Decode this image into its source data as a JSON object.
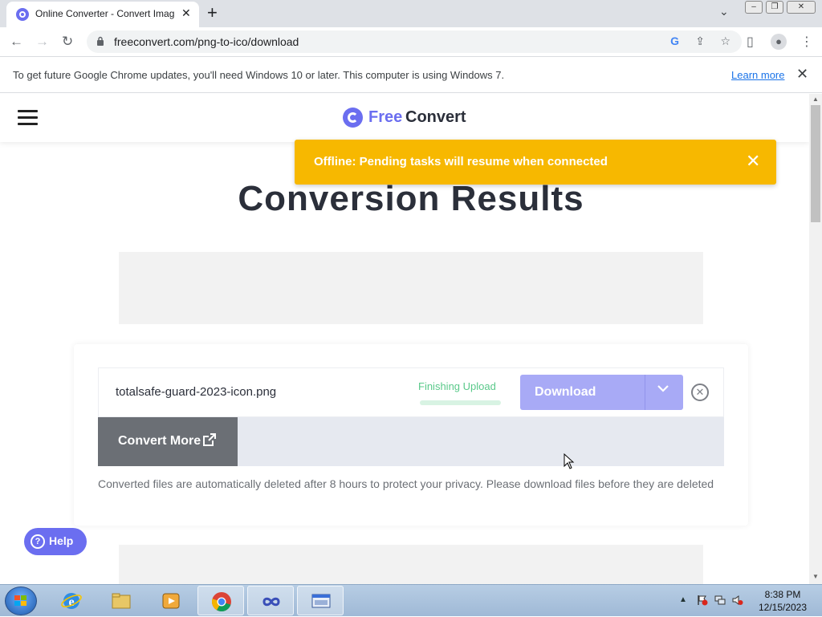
{
  "browser": {
    "tab_title": "Online Converter - Convert Imag",
    "tab_close": "✕",
    "new_tab": "+",
    "url": "freeconvert.com/png-to-ico/download"
  },
  "infobar": {
    "message": "To get future Google Chrome updates, you'll need Windows 10 or later. This computer is using Windows 7.",
    "learn_more": "Learn more",
    "close": "✕"
  },
  "site": {
    "logo_free": "Free",
    "logo_convert": "Convert"
  },
  "toast": {
    "message": "Offline: Pending tasks will resume when connected",
    "close": "✕"
  },
  "page": {
    "heading": "Conversion Results"
  },
  "file": {
    "name": "totalsafe-guard-2023-icon.png",
    "status": "Finishing Upload",
    "upload_progress": 0,
    "download_label": "Download"
  },
  "actions": {
    "convert_more": "Convert More"
  },
  "notice": "Converted files are automatically deleted after 8 hours to protect your privacy. Please download files before they are deleted",
  "help": {
    "label": "Help",
    "icon": "?"
  },
  "taskbar": {
    "time": "8:38 PM",
    "date": "12/15/2023",
    "items": [
      "explorer",
      "internet-explorer",
      "file-manager",
      "media-player",
      "chrome",
      "app-infinity",
      "keyboard-app"
    ]
  },
  "colors": {
    "brand": "#6b6ef0",
    "toast": "#f7b800",
    "download_button": "#a8aaf6",
    "convert_more": "#6b6f75",
    "status_green": "#5ac98a"
  }
}
